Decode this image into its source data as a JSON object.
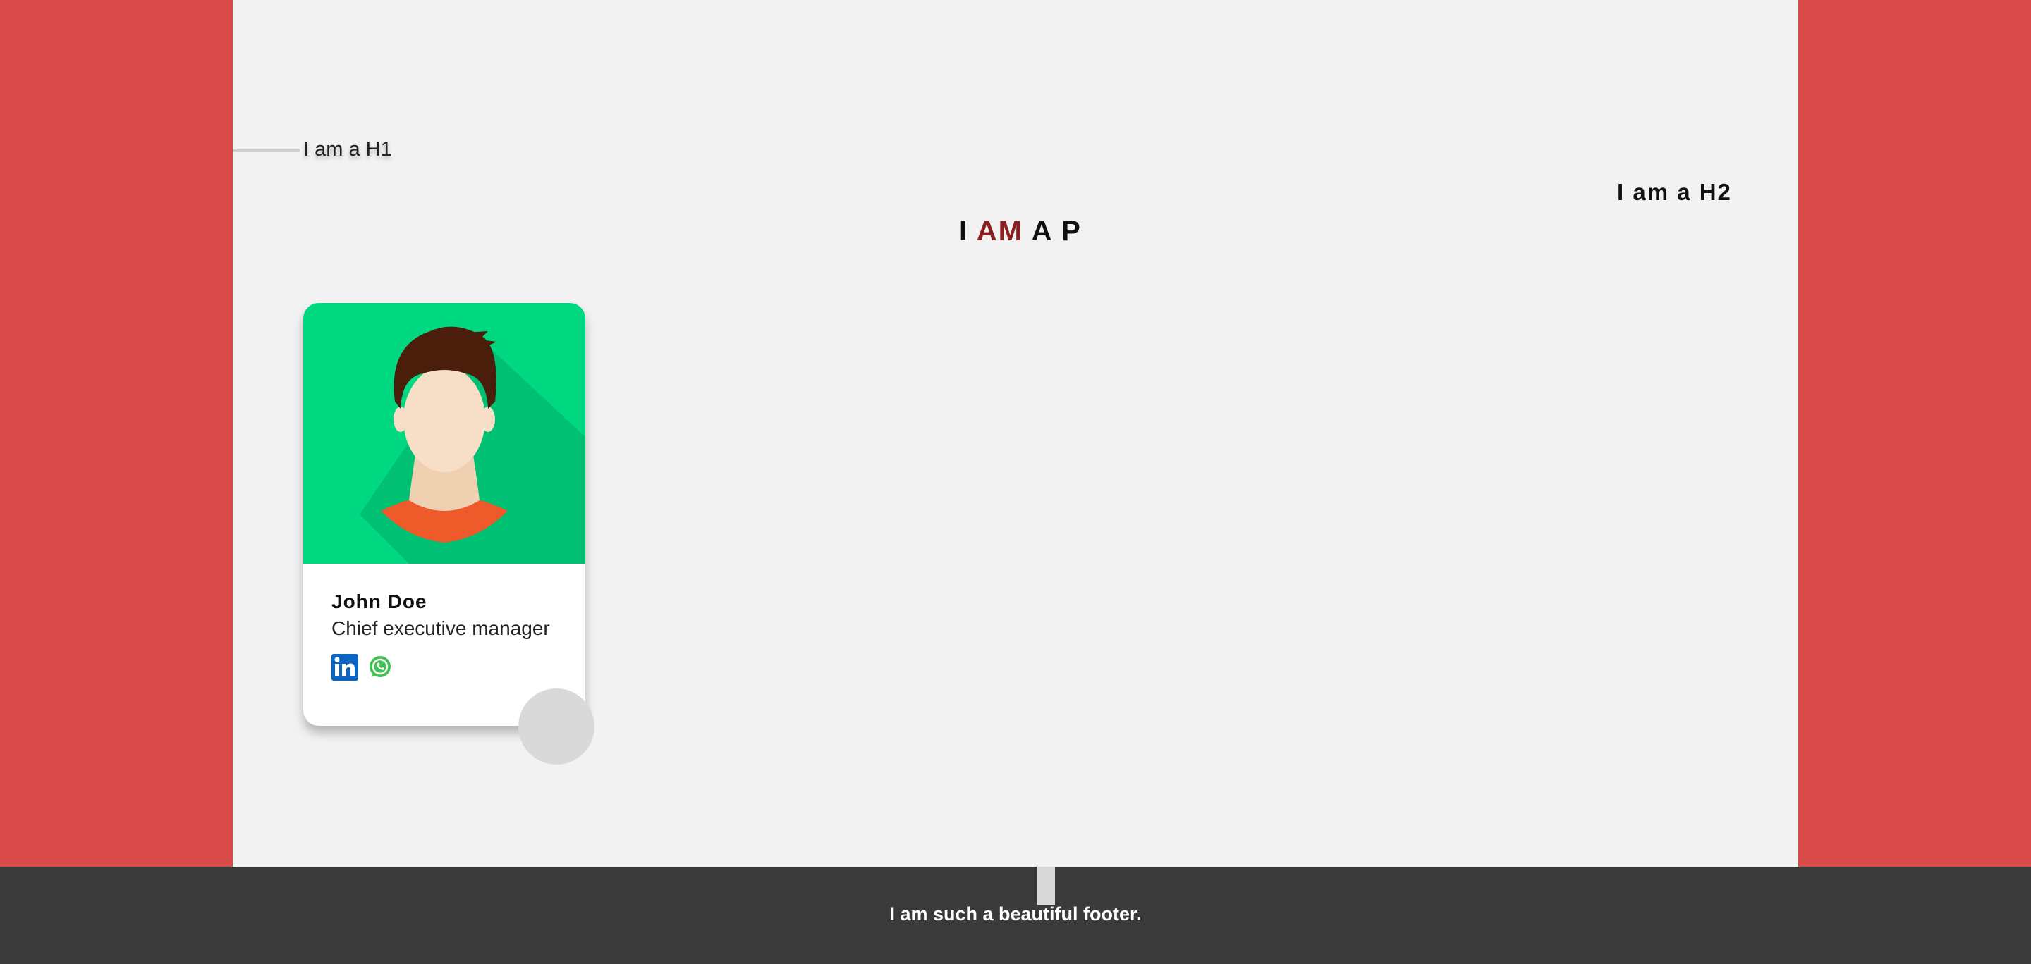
{
  "headings": {
    "h1": "I am a H1",
    "h2": "I am a H2",
    "p_prefix": "I ",
    "p_accent": "AM",
    "p_suffix": " A P"
  },
  "card": {
    "name": "John Doe",
    "role": "Chief executive manager",
    "avatar_icon": "male-avatar-illustration",
    "social": [
      {
        "icon": "linkedin-icon"
      },
      {
        "icon": "whatsapp-icon"
      }
    ]
  },
  "footer": {
    "text": "I am such a beautiful footer."
  },
  "colors": {
    "side_background": "#d84a4a",
    "content_background": "#f2f2f2",
    "accent": "#8b1e1e",
    "card_header": "#00d882",
    "footer_background": "#3a3a3a"
  }
}
